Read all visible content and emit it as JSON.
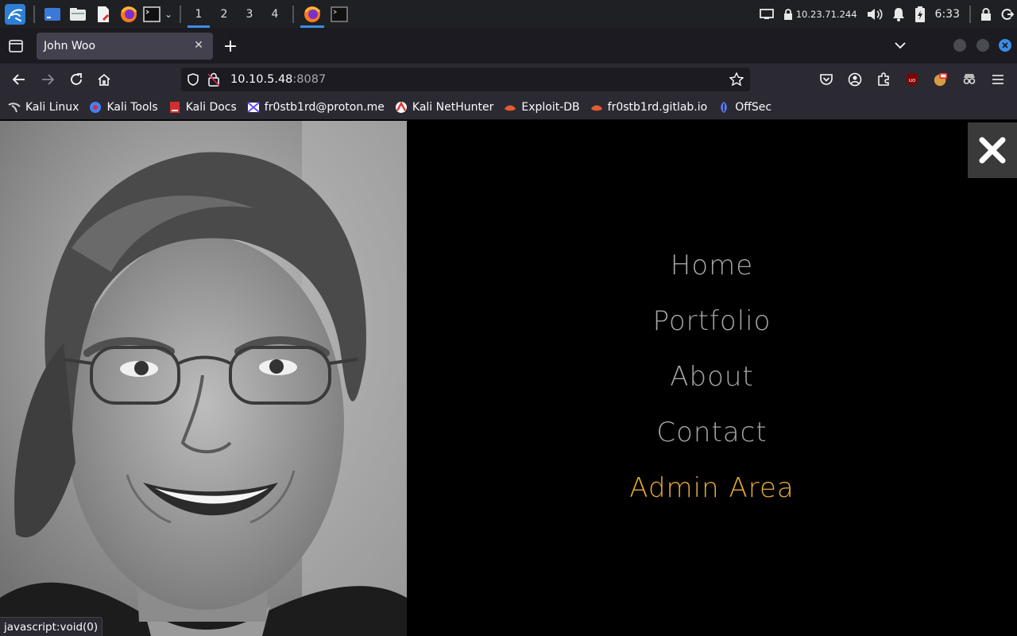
{
  "panel": {
    "workspaces": [
      "1",
      "2",
      "3",
      "4"
    ],
    "active_workspace": "1",
    "ip": "10.23.71.244",
    "time": "6:33"
  },
  "browser": {
    "tab_title": "John Woo",
    "url_host": "10.10.5.48",
    "url_port": ":8087",
    "bookmarks": [
      {
        "label": "Kali Linux",
        "icon": "kali-dragon-icon",
        "color": "#cfcfcf"
      },
      {
        "label": "Kali Tools",
        "icon": "kali-tools-icon",
        "color": "#3f83f8"
      },
      {
        "label": "Kali Docs",
        "icon": "kali-docs-icon",
        "color": "#d32f2f"
      },
      {
        "label": "fr0stb1rd@proton.me",
        "icon": "proton-icon",
        "color": "#6d4aff"
      },
      {
        "label": "Kali NetHunter",
        "icon": "nethunter-icon",
        "color": "#e53935"
      },
      {
        "label": "Exploit-DB",
        "icon": "exploitdb-icon",
        "color": "#e65b2e"
      },
      {
        "label": "fr0stb1rd.gitlab.io",
        "icon": "gitlab-icon",
        "color": "#e65b2e"
      },
      {
        "label": "OffSec",
        "icon": "offsec-icon",
        "color": "#5b7cfa"
      }
    ],
    "status_text": "javascript:void(0)"
  },
  "page": {
    "menu": [
      {
        "label": "Home",
        "highlight": false
      },
      {
        "label": "Portfolio",
        "highlight": false
      },
      {
        "label": "About",
        "highlight": false
      },
      {
        "label": "Contact",
        "highlight": false
      },
      {
        "label": "Admin Area",
        "highlight": true
      }
    ],
    "accent_color": "#e5a93a",
    "menu_color": "#a6a6a6"
  }
}
